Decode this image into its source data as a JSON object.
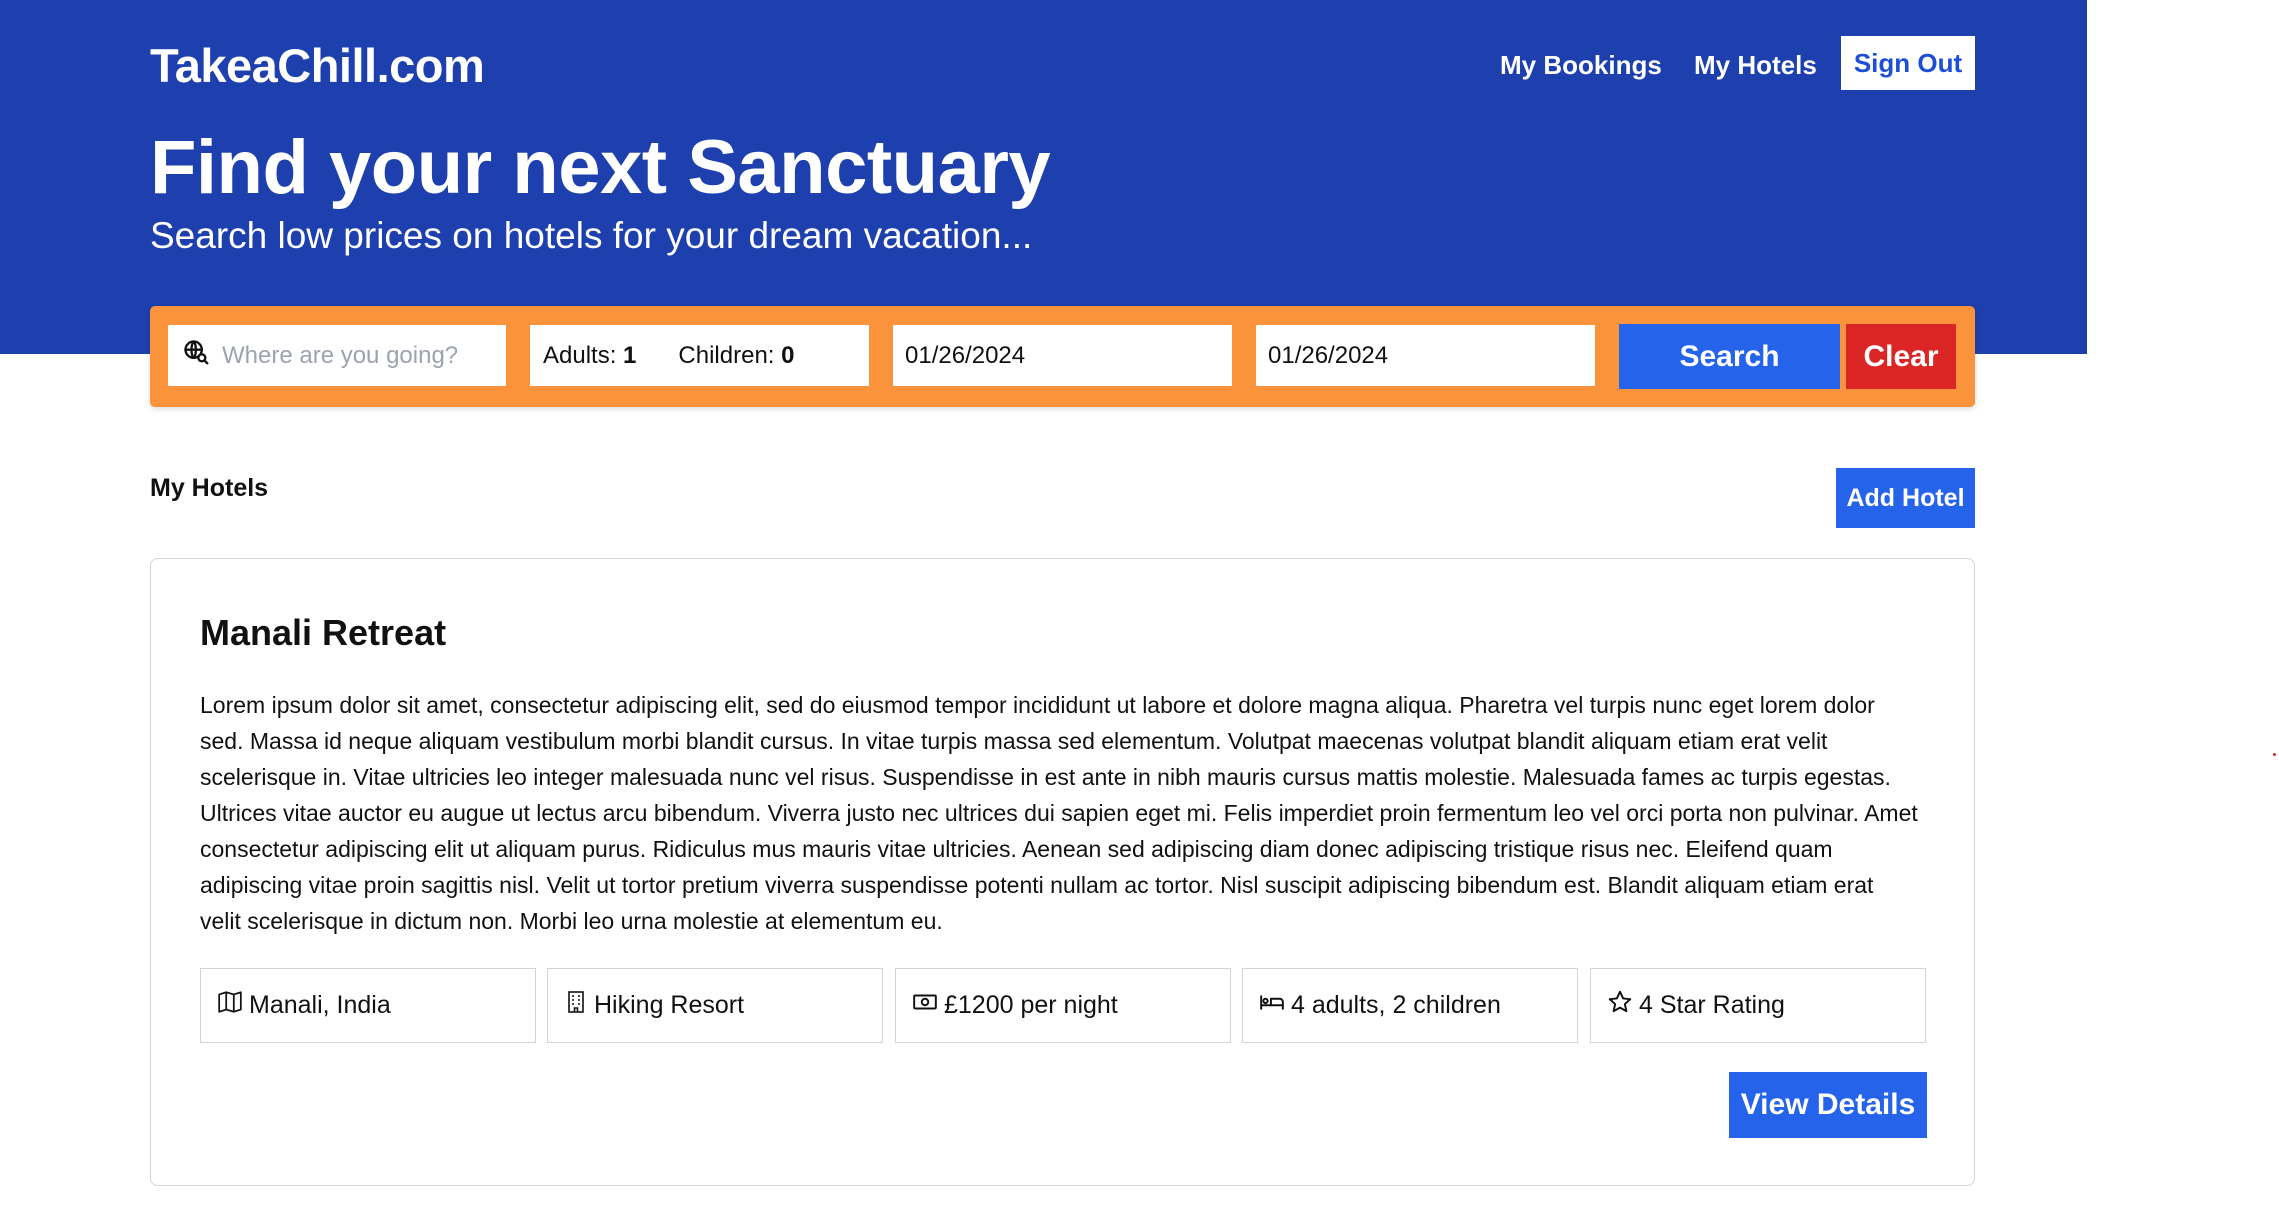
{
  "header": {
    "logo": "TakeaChill.com",
    "nav": {
      "my_bookings": "My Bookings",
      "my_hotels": "My Hotels",
      "sign_out": "Sign Out"
    },
    "title": "Find your next Sanctuary",
    "subtitle": "Search low prices on hotels for your dream vacation..."
  },
  "search": {
    "destination_placeholder": "Where are you going?",
    "destination_icon": "globe-search-icon",
    "adults_label": "Adults:",
    "adults_value": "1",
    "children_label": "Children:",
    "children_value": "0",
    "check_in": "01/26/2024",
    "check_out": "01/26/2024",
    "search_label": "Search",
    "clear_label": "Clear"
  },
  "section": {
    "title": "My Hotels",
    "add_label": "Add Hotel"
  },
  "hotel": {
    "name": "Manali Retreat",
    "description": "Lorem ipsum dolor sit amet, consectetur adipiscing elit, sed do eiusmod tempor incididunt ut labore et dolore magna aliqua. Pharetra vel turpis nunc eget lorem dolor sed. Massa id neque aliquam vestibulum morbi blandit cursus. In vitae turpis massa sed elementum. Volutpat maecenas volutpat blandit aliquam etiam erat velit scelerisque in. Vitae ultricies leo integer malesuada nunc vel risus. Suspendisse in est ante in nibh mauris cursus mattis molestie. Malesuada fames ac turpis egestas. Ultrices vitae auctor eu augue ut lectus arcu bibendum. Viverra justo nec ultrices dui sapien eget mi. Felis imperdiet proin fermentum leo vel orci porta non pulvinar. Amet consectetur adipiscing elit ut aliquam purus. Ridiculus mus mauris vitae ultricies. Aenean sed adipiscing diam donec adipiscing tristique risus nec. Eleifend quam adipiscing vitae proin sagittis nisl. Velit ut tortor pretium viverra suspendisse potenti nullam ac tortor. Nisl suscipit adipiscing bibendum est. Blandit aliquam etiam erat velit scelerisque in dictum non. Morbi leo urna molestie at elementum eu.",
    "chips": [
      {
        "icon": "map-icon",
        "text": "Manali, India"
      },
      {
        "icon": "building-icon",
        "text": "Hiking Resort"
      },
      {
        "icon": "money-icon",
        "text": "£1200 per night"
      },
      {
        "icon": "bed-icon",
        "text": "4 adults, 2 children"
      },
      {
        "icon": "star-icon",
        "text": "4 Star Rating"
      }
    ],
    "view_label": "View Details"
  },
  "colors": {
    "header_bg": "#1e40af",
    "search_bar_bg": "#fb923c",
    "primary_button": "#2563eb",
    "clear_button": "#dc2626"
  }
}
